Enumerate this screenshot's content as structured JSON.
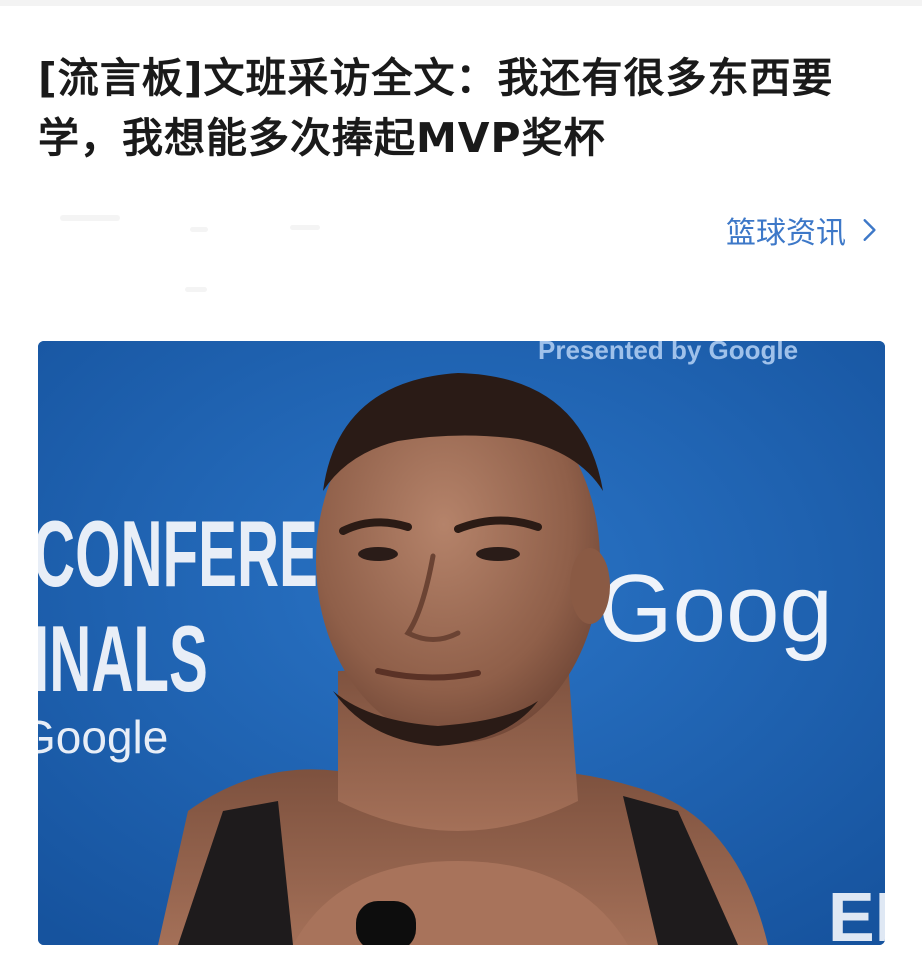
{
  "article": {
    "title": "[流言板]文班采访全文：我还有很多东西要学，我想能多次捧起MVP奖杯",
    "category_label": "篮球资讯",
    "category_icon": "chevron-right-icon",
    "accent_color": "#3d78c8"
  },
  "photo": {
    "backdrop_color": "#1d5fb0",
    "backdrop_text": {
      "top": "Presented by Google",
      "left_line1": "CONFEREN",
      "left_line2": "INALS",
      "left_line3": "Google",
      "right": "Goog",
      "bottom_right": "ED"
    }
  }
}
